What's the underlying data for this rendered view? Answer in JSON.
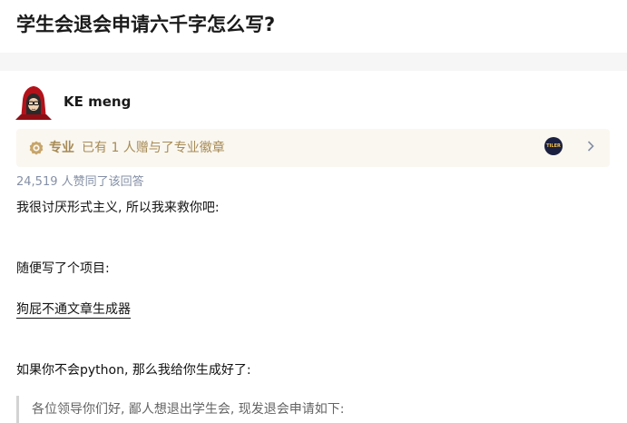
{
  "question": {
    "title": "学生会退会申请六千字怎么写?"
  },
  "author": {
    "name": "KE meng",
    "avatar_icon": "hooded-avatar-icon"
  },
  "pro_bar": {
    "label": "专业",
    "text": "已有 1 人赠与了专业徽章",
    "icon": "pro-badge-icon",
    "badge_text": "TILER",
    "arrow": "chevron-right-icon"
  },
  "answer": {
    "likes": "24,519 人赞同了该回答",
    "p1": "我很讨厌形式主义, 所以我来救你吧:",
    "p2": "随便写了个项目:",
    "link": "狗屁不通文章生成器",
    "p3": "如果你不会python, 那么我给你生成好了:",
    "quote": "各位领导你们好, 鄙人想退出学生会, 现发退会申请如下:"
  },
  "colors": {
    "accent_gold": "#a68a55",
    "muted": "#8590a6"
  }
}
